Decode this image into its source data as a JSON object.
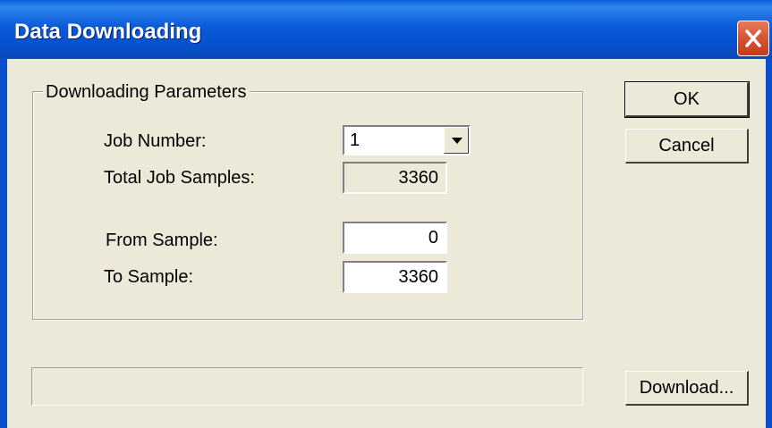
{
  "window": {
    "title": "Data Downloading"
  },
  "group": {
    "title": "Downloading Parameters"
  },
  "fields": {
    "job_number_label": "Job Number:",
    "job_number_value": "1",
    "total_samples_label": "Total Job Samples:",
    "total_samples_value": "3360",
    "from_sample_label": "From Sample:",
    "from_sample_value": "0",
    "to_sample_label": "To Sample:",
    "to_sample_value": "3360"
  },
  "buttons": {
    "ok": "OK",
    "cancel": "Cancel",
    "download": "Download..."
  },
  "status": {
    "text": ""
  },
  "colors": {
    "titlebar": "#0a5ad6",
    "close": "#d65433",
    "face": "#ece9d8"
  },
  "icons": {
    "close": "close-icon",
    "dropdown": "chevron-down-icon"
  }
}
